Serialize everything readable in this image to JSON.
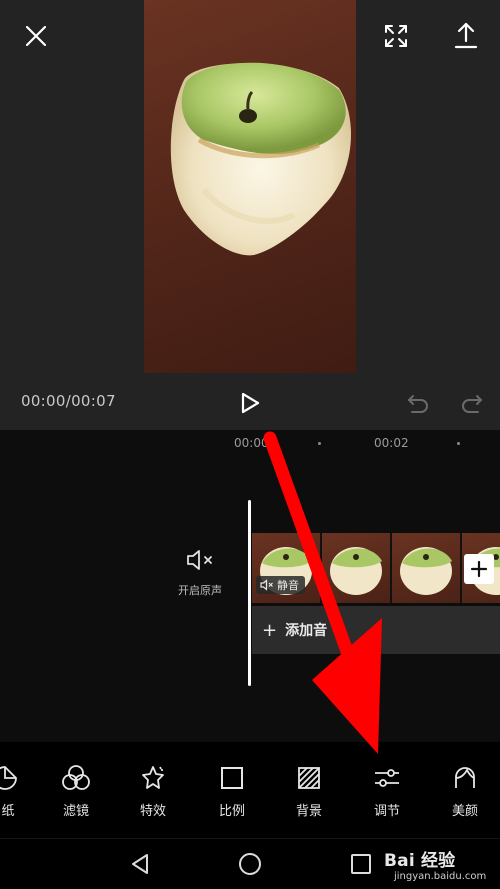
{
  "header": {
    "close_icon": "close-icon",
    "fullscreen_icon": "fullscreen-icon",
    "export_icon": "export-icon"
  },
  "player": {
    "timecode": "00:00/00:07",
    "play_icon": "play-icon",
    "undo_icon": "undo-icon",
    "redo_icon": "redo-icon"
  },
  "timeline": {
    "ruler": [
      "00:00",
      "00:02"
    ],
    "original_sound_label": "开启原声",
    "mute_tag": "静音",
    "add_audio_label": "添加音频",
    "add_audio_visible": "添加音"
  },
  "toolbar": {
    "items": [
      {
        "label": "纸",
        "icon": "sticker-icon"
      },
      {
        "label": "滤镜",
        "icon": "filter-icon"
      },
      {
        "label": "特效",
        "icon": "effects-icon"
      },
      {
        "label": "比例",
        "icon": "ratio-icon"
      },
      {
        "label": "背景",
        "icon": "background-icon"
      },
      {
        "label": "调节",
        "icon": "adjust-icon"
      },
      {
        "label": "美颜",
        "icon": "beauty-icon"
      }
    ]
  },
  "watermark": {
    "main": "Bai 经验",
    "sub": "jingyan.baidu.com"
  },
  "colors": {
    "accent": "#ff0000",
    "background": "#000000",
    "preview_bg": "#232323"
  }
}
